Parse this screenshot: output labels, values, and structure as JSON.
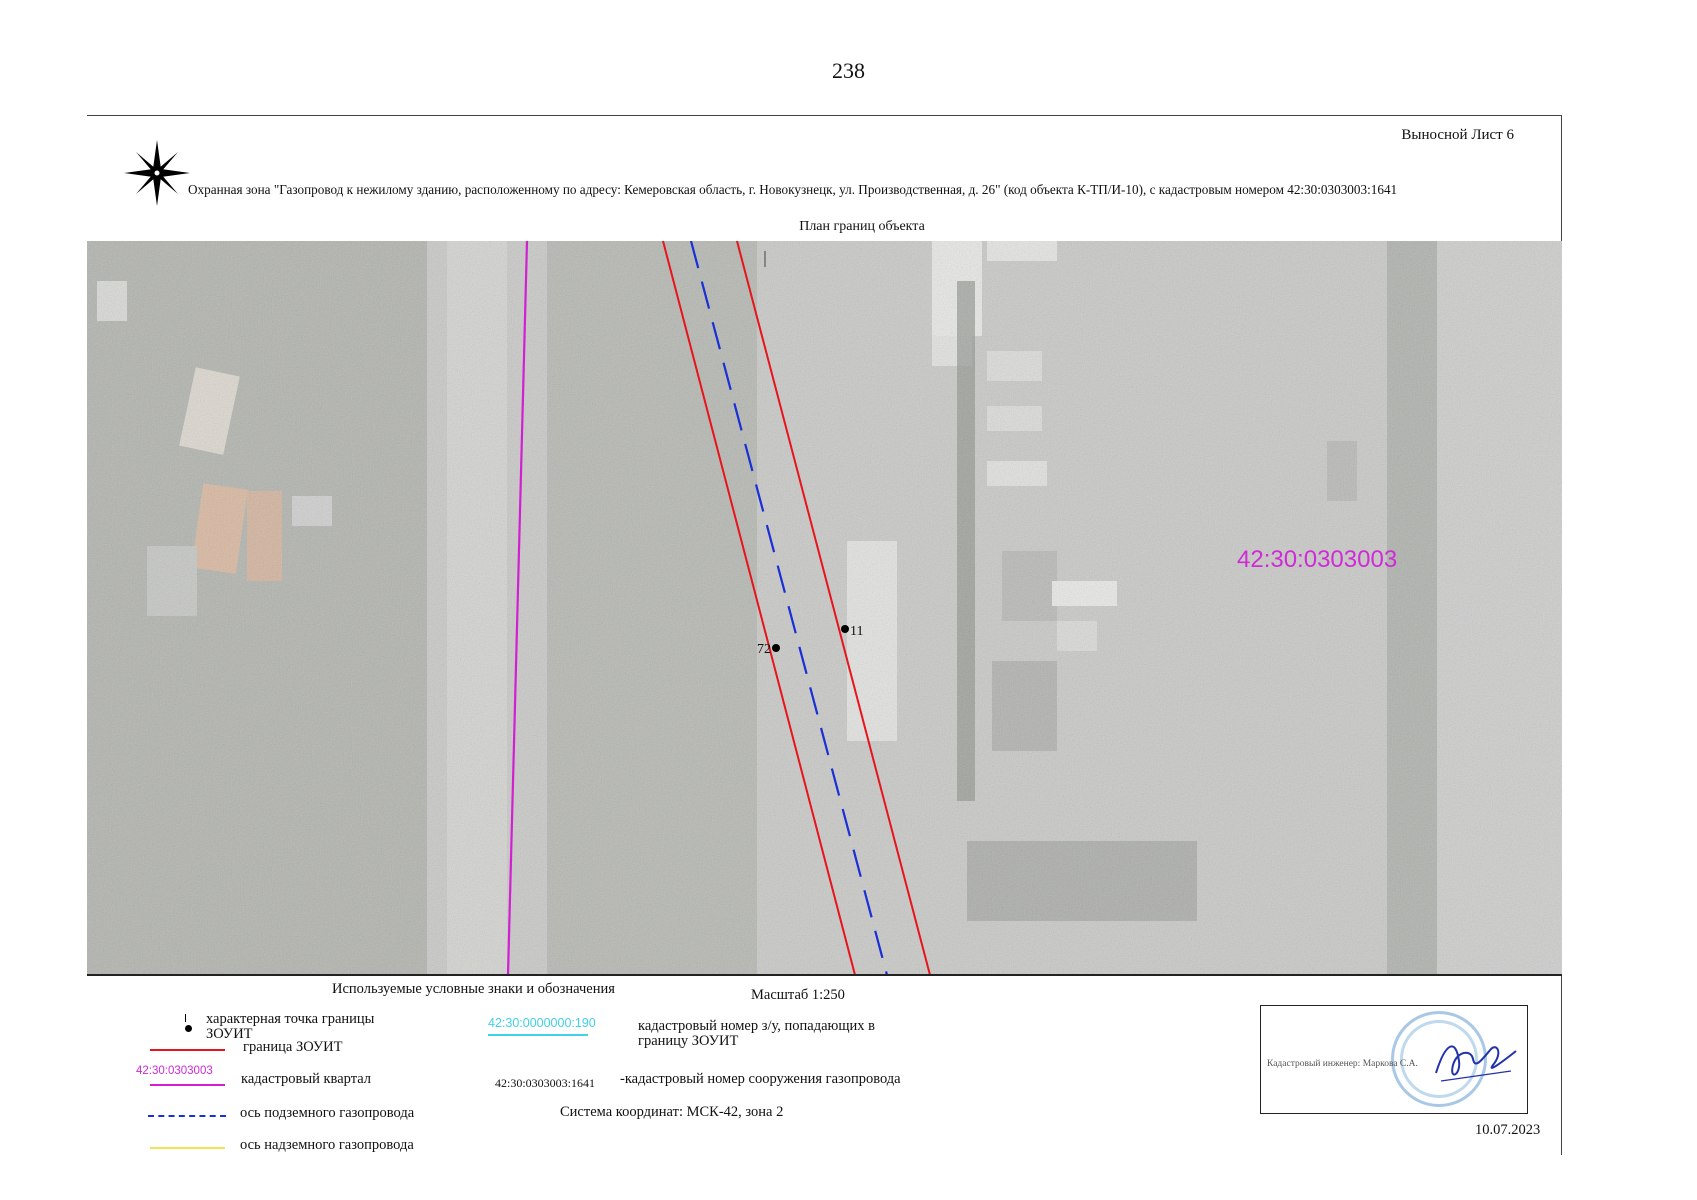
{
  "page_number": "238",
  "sheet": {
    "label": "Выносной Лист 6",
    "object_title": "Охранная зона \"Газопровод к нежилому зданию, расположенному по адресу: Кемеровская область, г. Новокузнецк, ул. Производственная, д. 26\" (код объекта К-ТП/И-10), с кадастровым номером 42:30:0303003:1641",
    "plan_title": "План границ объекта"
  },
  "map": {
    "quarter_label": "42:30:0303003",
    "points": [
      {
        "id": "11",
        "label": "11"
      },
      {
        "id": "72",
        "label": "72"
      }
    ],
    "colors": {
      "zone_boundary": "#e8141c",
      "pipeline_axis": "#1a2fd6",
      "quarter_boundary": "#d21fd2",
      "quarter_label": "#cf2bd6"
    }
  },
  "legend": {
    "title": "Используемые условные знаки и обозначения",
    "items": {
      "char_point": "характерная точка границы ЗОУИТ",
      "zone_boundary": "граница ЗОУИТ",
      "quarter_sample": "42:30:0303003",
      "quarter": "кадастровый квартал",
      "underground_axis": "ось подземного газопровода",
      "aboveground_axis": "ось надземного газопровода",
      "parcel_sample": "42:30:0000000:190",
      "parcel": "кадастровый номер з/у, попадающих в границу ЗОУИТ",
      "structure_sample": "42:30:0303003:1641",
      "structure": "-кадастровый  номер сооружения газопровода"
    },
    "scale": "Масштаб 1:250",
    "coord_system": "Система координат: МСК-42, зона 2"
  },
  "signature": {
    "engineer_label": "Кадастровый инженер:",
    "engineer_name": "Маркова С.А.",
    "date": "10.07.2023"
  }
}
